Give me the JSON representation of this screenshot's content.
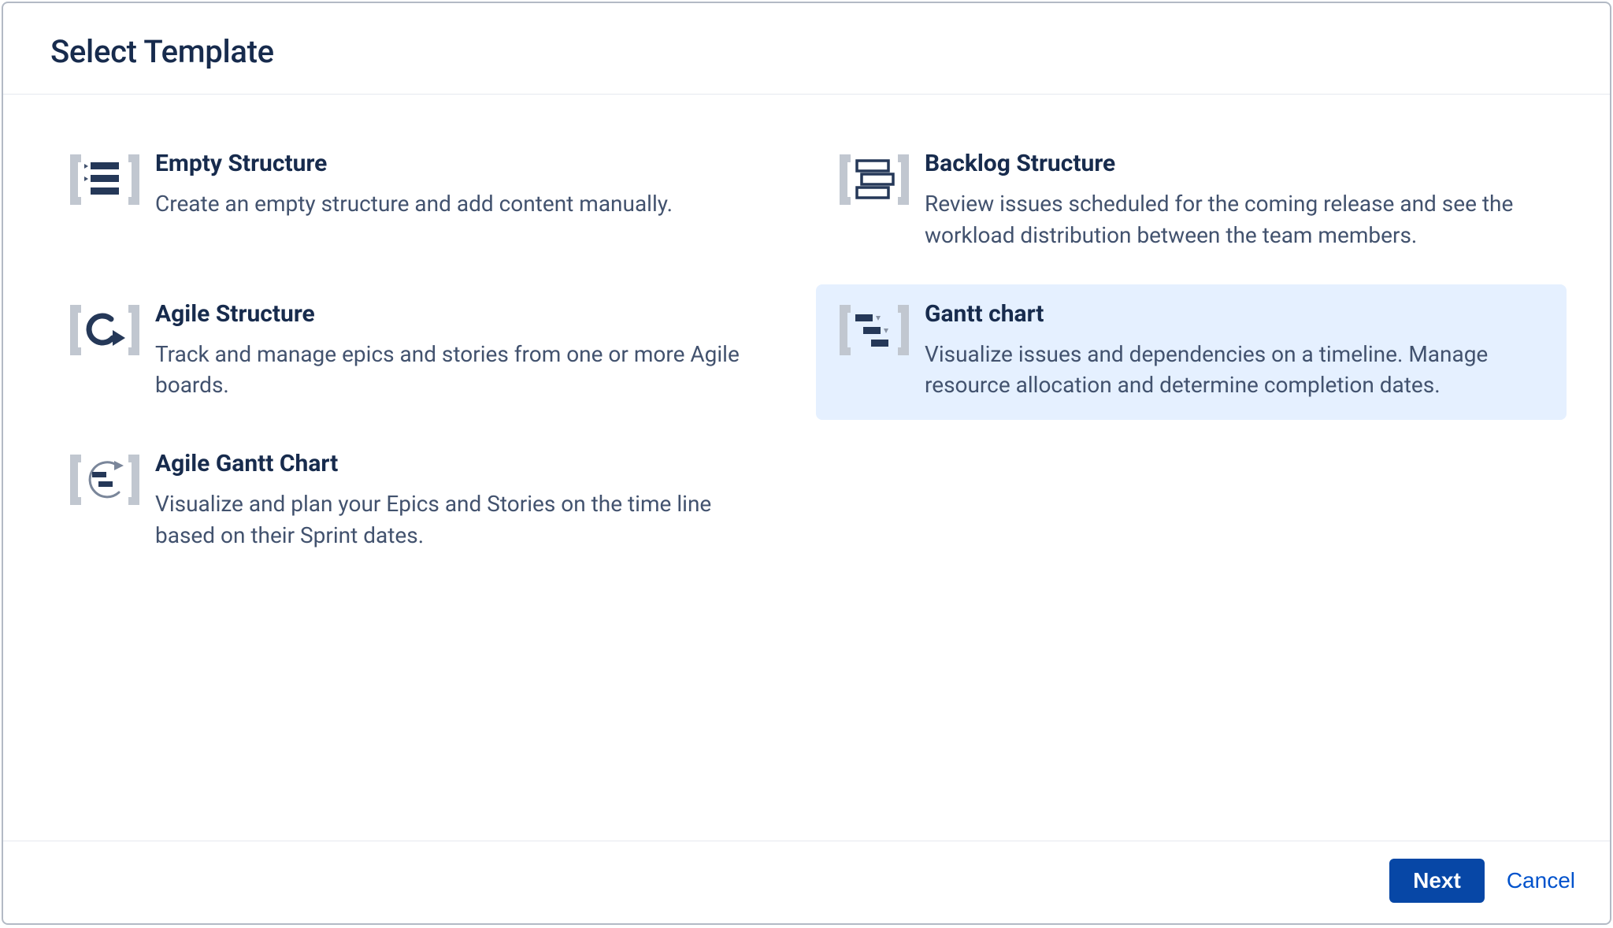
{
  "dialog": {
    "title": "Select Template"
  },
  "templates": {
    "empty": {
      "title": "Empty Structure",
      "desc": "Create an empty structure and add content manually."
    },
    "backlog": {
      "title": "Backlog Structure",
      "desc": "Review issues scheduled for the coming release and see the workload distribution between the team members."
    },
    "agile": {
      "title": "Agile Structure",
      "desc": "Track and manage epics and stories from one or more Agile boards."
    },
    "gantt": {
      "title": "Gantt chart",
      "desc": "Visualize issues and dependencies on a timeline. Manage resource allocation and determine completion dates."
    },
    "agile_gantt": {
      "title": "Agile Gantt Chart",
      "desc": "Visualize and plan your Epics and Stories on the time line based on their Sprint dates."
    }
  },
  "footer": {
    "next": "Next",
    "cancel": "Cancel"
  },
  "colors": {
    "accent": "#0747a6",
    "bracket": "#c1c7d0",
    "navy": "#253858",
    "selected_bg": "#e5f0ff"
  }
}
